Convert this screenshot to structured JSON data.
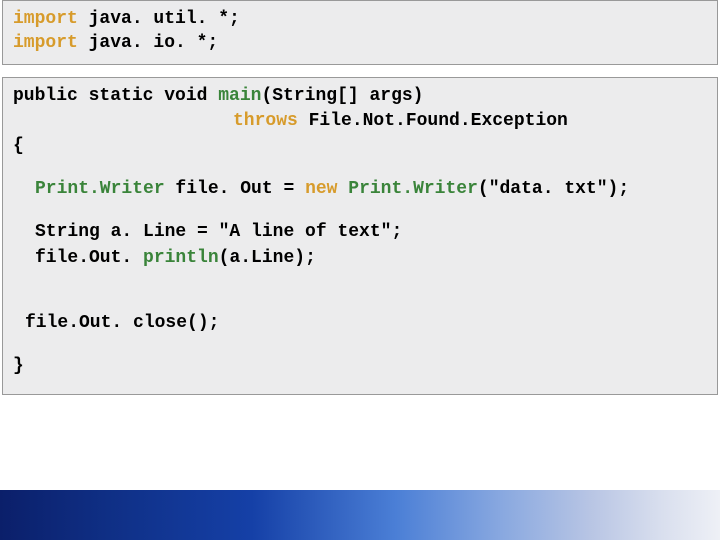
{
  "imports": {
    "kw": "import",
    "l1": " java. util. *;",
    "l2": " java. io. *;"
  },
  "main": {
    "sig1a": "public static void ",
    "sig1b": "main",
    "sig1c": "(String[] args)",
    "throws_kw": "throws",
    "throws_type": " File.Not.Found.Exception",
    "openBrace": "{",
    "pw1a": "Print.Writer",
    "pw1b": " file. Out = ",
    "pw1c": "new",
    "pw1d": " Print.Writer",
    "pw1e": "(\"data. txt\");",
    "strLine": "String a. Line = \"A line of text\";",
    "callA": "file.Out. ",
    "callB": "println",
    "callC": "(a.Line);",
    "closeLine": "file.Out. close();",
    "closeBrace": "}"
  }
}
